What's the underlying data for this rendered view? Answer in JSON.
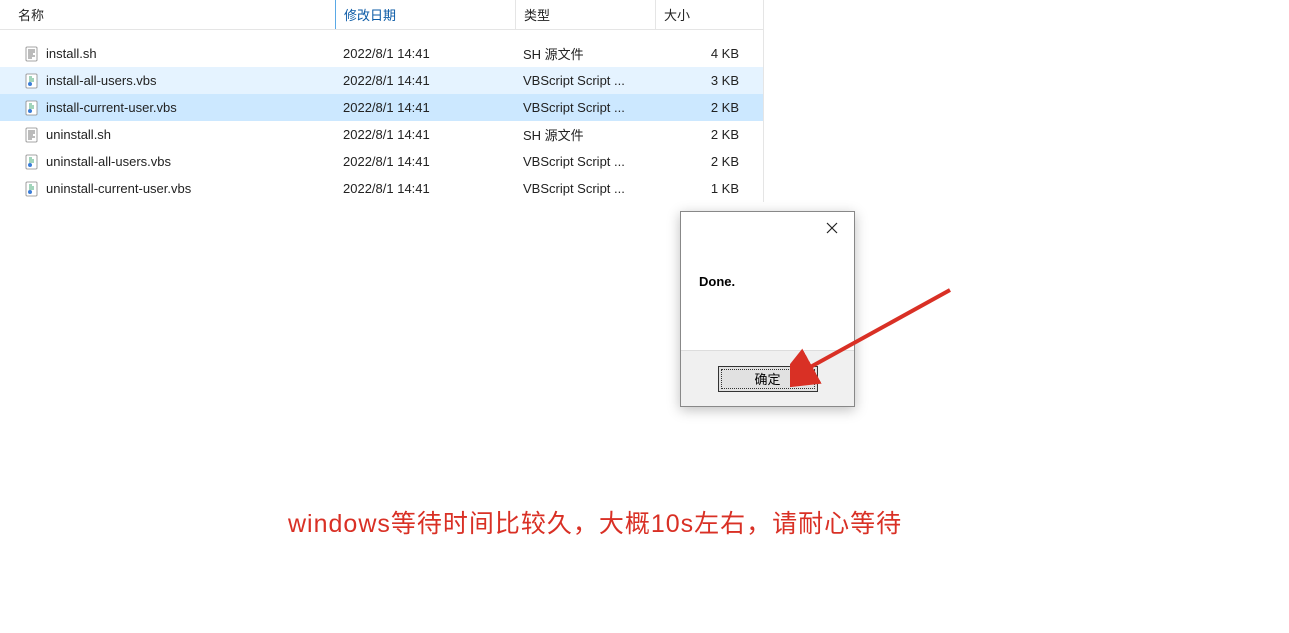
{
  "columns": {
    "name": "名称",
    "date": "修改日期",
    "type": "类型",
    "size": "大小"
  },
  "files": [
    {
      "name": "install.sh",
      "date": "2022/8/1 14:41",
      "type": "SH 源文件",
      "size": "4 KB",
      "icon": "sh",
      "state": ""
    },
    {
      "name": "install-all-users.vbs",
      "date": "2022/8/1 14:41",
      "type": "VBScript Script ...",
      "size": "3 KB",
      "icon": "vbs",
      "state": "hover"
    },
    {
      "name": "install-current-user.vbs",
      "date": "2022/8/1 14:41",
      "type": "VBScript Script ...",
      "size": "2 KB",
      "icon": "vbs",
      "state": "selected"
    },
    {
      "name": "uninstall.sh",
      "date": "2022/8/1 14:41",
      "type": "SH 源文件",
      "size": "2 KB",
      "icon": "sh",
      "state": ""
    },
    {
      "name": "uninstall-all-users.vbs",
      "date": "2022/8/1 14:41",
      "type": "VBScript Script ...",
      "size": "2 KB",
      "icon": "vbs",
      "state": ""
    },
    {
      "name": "uninstall-current-user.vbs",
      "date": "2022/8/1 14:41",
      "type": "VBScript Script ...",
      "size": "1 KB",
      "icon": "vbs",
      "state": ""
    }
  ],
  "dialog": {
    "message": "Done.",
    "ok_label": "确定"
  },
  "annotation": "windows等待时间比较久，大概10s左右，请耐心等待"
}
